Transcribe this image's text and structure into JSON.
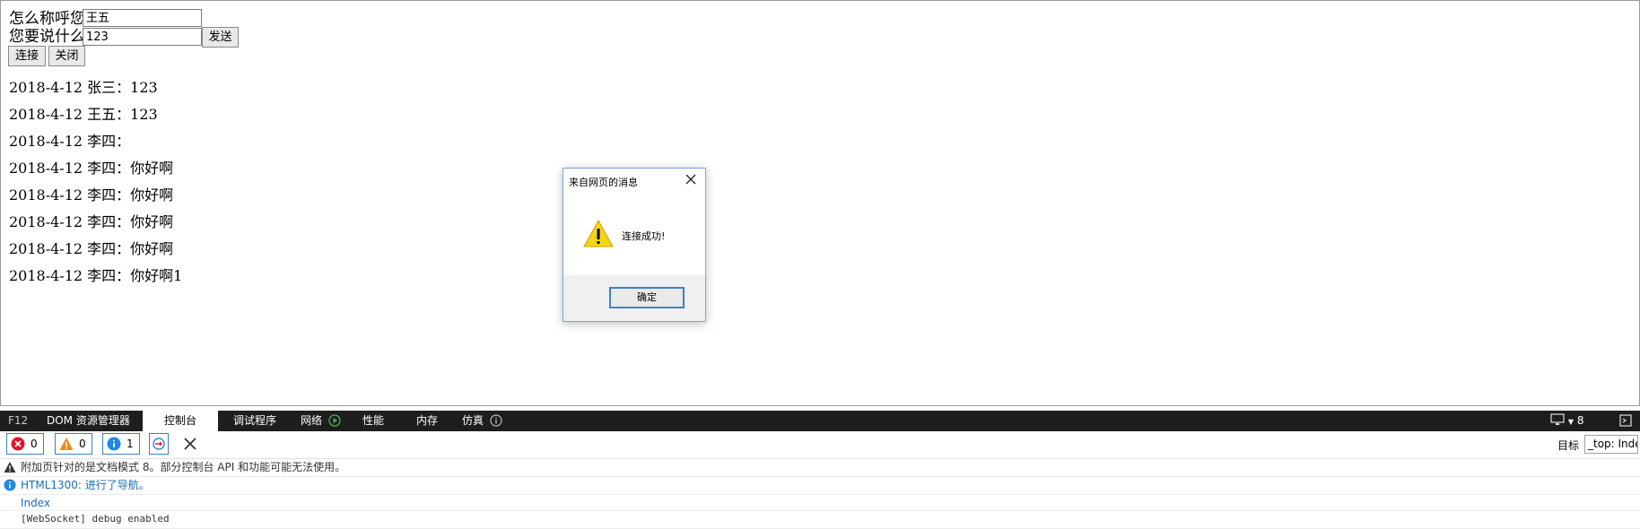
{
  "form": {
    "name_label": "怎么称呼您？",
    "name_value": "王五",
    "message_label": "您要说什么？",
    "message_value": "123",
    "send_button": "发送",
    "connect_button": "连接",
    "close_button": "关闭"
  },
  "messages": [
    "2018-4-12 张三：123",
    "2018-4-12 王五：123",
    "2018-4-12 李四：",
    "2018-4-12 李四：你好啊",
    "2018-4-12 李四：你好啊",
    "2018-4-12 李四：你好啊",
    "2018-4-12 李四：你好啊",
    "2018-4-12 李四：你好啊1"
  ],
  "dialog": {
    "title": "来自网页的消息",
    "text": "连接成功!",
    "ok_button": "确定",
    "icons": {
      "close": "close-icon",
      "warning": "warning-icon"
    }
  },
  "devtools": {
    "tabs": [
      {
        "label": "F12"
      },
      {
        "label": "DOM 资源管理器"
      },
      {
        "label": "控制台"
      },
      {
        "label": "调试程序"
      },
      {
        "label": "网络"
      },
      {
        "label": "性能"
      },
      {
        "label": "内存"
      },
      {
        "label": "仿真"
      }
    ],
    "active_tab": "控制台",
    "right_count": "8",
    "counters": {
      "errors": "0",
      "warnings": "0",
      "info": "1"
    },
    "target_label": "目标",
    "target_value": "_top: Index",
    "console_lines": [
      {
        "kind": "warning",
        "text": "附加页针对的是文档模式 8。部分控制台 API 和功能可能无法使用。"
      },
      {
        "kind": "info",
        "text": "HTML1300: 进行了导航。"
      },
      {
        "kind": "plain",
        "text": "Index"
      },
      {
        "kind": "plain",
        "text": "[WebSocket] debug enabled"
      }
    ],
    "colors": {
      "bar": "#1e1e1e",
      "accent": "#3c7fd0",
      "info_text": "#1a6bb6"
    }
  }
}
